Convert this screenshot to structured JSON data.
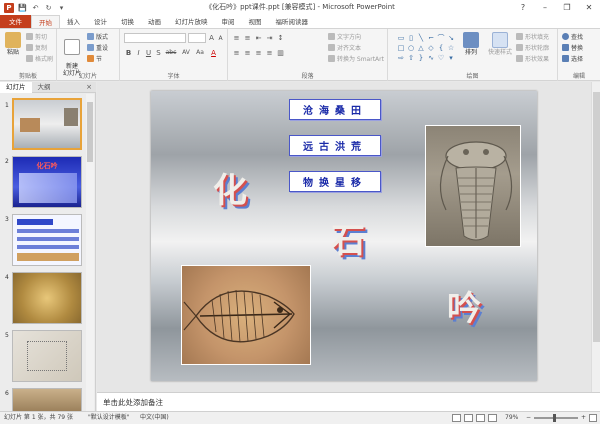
{
  "window": {
    "title": "《化石吟》ppt课件.ppt [兼容模式] - Microsoft PowerPoint",
    "app_icon_letter": "P",
    "controls": {
      "help": "?",
      "minimize": "–",
      "restore": "❐",
      "close": "✕"
    }
  },
  "quick_access": {
    "save": "💾",
    "undo": "↶",
    "redo": "↻",
    "more": "▾"
  },
  "menu": {
    "tabs": [
      "文件",
      "开始",
      "插入",
      "设计",
      "切换",
      "动画",
      "幻灯片放映",
      "审阅",
      "视图",
      "福昕阅读器"
    ],
    "active": "开始"
  },
  "ribbon": {
    "clipboard": {
      "label": "剪贴板",
      "paste": "粘贴",
      "cut": "剪切",
      "copy": "复制",
      "format_painter": "格式刷"
    },
    "slides": {
      "label": "幻灯片",
      "new_slide": "新建\n幻灯片",
      "layout": "版式",
      "reset": "重设",
      "section": "节"
    },
    "font": {
      "label": "字体",
      "bold": "B",
      "italic": "I",
      "underline": "U",
      "strike": "S",
      "shadow": "abc",
      "spacing": "AV",
      "case": "Aa",
      "grow": "A",
      "shrink": "A"
    },
    "paragraph": {
      "label": "段落",
      "text_direction": "文字方向",
      "align_text": "对齐文本",
      "smartart": "转换为 SmartArt"
    },
    "drawing": {
      "label": "绘图",
      "arrange": "排列",
      "quick_styles": "快速样式",
      "shape_fill": "形状填充",
      "shape_outline": "形状轮廓",
      "shape_effects": "形状效果"
    },
    "editing": {
      "label": "编辑",
      "find": "查找",
      "replace": "替换",
      "select": "选择"
    }
  },
  "panel": {
    "tabs": [
      "幻灯片",
      "大纲"
    ],
    "close": "×",
    "thumbs": [
      {
        "num": "1",
        "selected": true
      },
      {
        "num": "2",
        "title": "化石吟"
      },
      {
        "num": "3"
      },
      {
        "num": "4"
      },
      {
        "num": "5"
      },
      {
        "num": "6"
      }
    ]
  },
  "slide": {
    "idioms": [
      "沧海桑田",
      "远古洪荒",
      "物换星移"
    ],
    "title_chars": [
      "化",
      "石",
      "吟"
    ]
  },
  "notes": {
    "placeholder": "单击此处添加备注"
  },
  "status": {
    "slide_info": "幻灯片 第 1 张，共 79 张",
    "theme": "\"默认设计模板\"",
    "language": "中文(中国)",
    "zoom": "79%",
    "zoom_level": 0.46,
    "zoom_minus": "−",
    "zoom_plus": "+"
  },
  "colors": {
    "accent": "#c43e1c",
    "idiom_text": "#1a2aa8",
    "shadow_red": "#d4504e",
    "shadow_blue": "#5c7fd1"
  }
}
